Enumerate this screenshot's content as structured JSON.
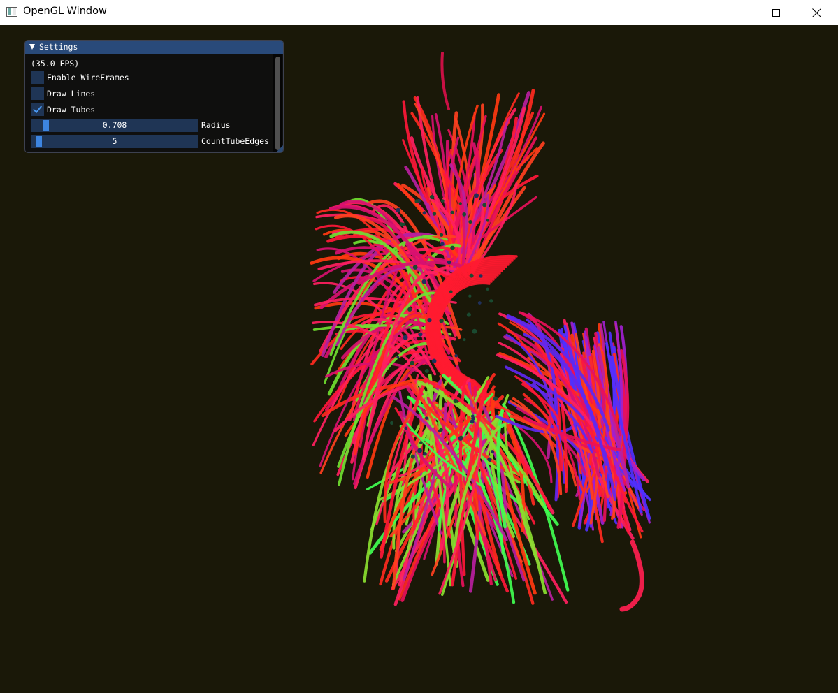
{
  "window": {
    "title": "OpenGL Window",
    "controls": [
      "minimize",
      "maximize",
      "close"
    ]
  },
  "viewport": {
    "background": "#1a1808",
    "render_content": "fiber tractography tubes"
  },
  "settings_panel": {
    "title": "Settings",
    "fps_text": "(35.0 FPS)",
    "checkboxes": [
      {
        "label": "Enable WireFrames",
        "checked": false
      },
      {
        "label": "Draw Lines",
        "checked": false
      },
      {
        "label": "Draw Tubes",
        "checked": true
      }
    ],
    "sliders": [
      {
        "label": "Radius",
        "value": "0.708"
      },
      {
        "label": "CountTubeEdges",
        "value": "5"
      }
    ]
  },
  "colors": {
    "panel_header": "#294a7a",
    "frame_bg": "#1f3555",
    "accent": "#3d85e0",
    "fiber_red": "#ff1a3a",
    "fiber_green": "#40ff40",
    "fiber_blue": "#4030ff"
  }
}
